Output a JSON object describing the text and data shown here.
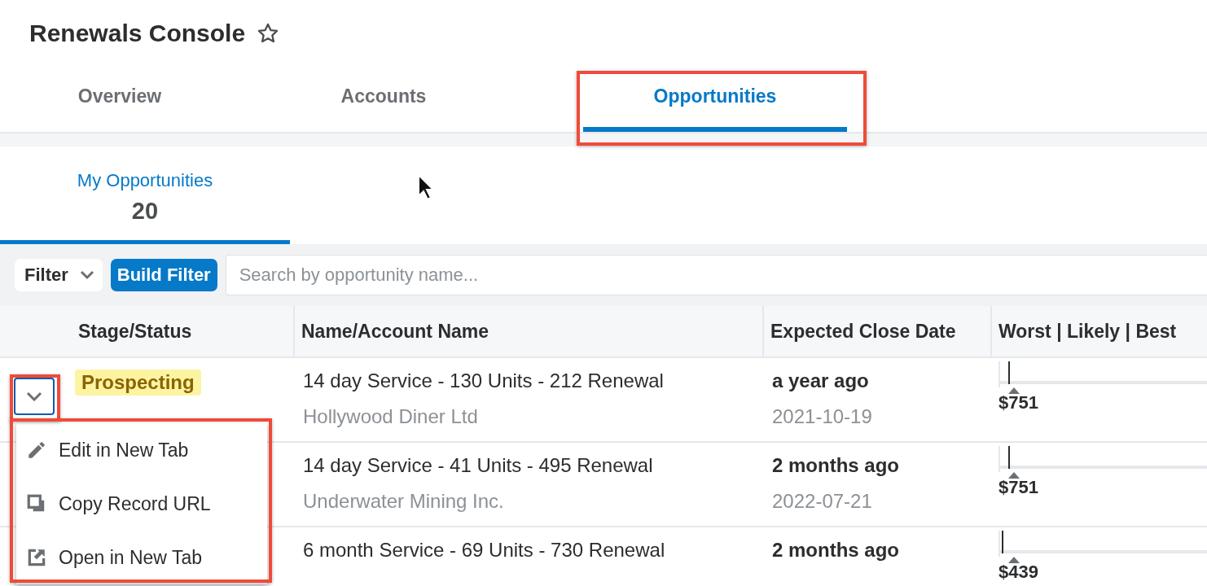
{
  "page": {
    "title": "Renewals Console"
  },
  "tabs": [
    {
      "label": "Overview",
      "selected": false
    },
    {
      "label": "Accounts",
      "selected": false
    },
    {
      "label": "Opportunities",
      "selected": true
    }
  ],
  "list_tabs": [
    {
      "label": "My Opportunities",
      "count": "20",
      "selected": true
    }
  ],
  "filter": {
    "filter_label": "Filter",
    "build_filter": "Build Filter",
    "search": {
      "placeholder": "Search by opportunity name..."
    }
  },
  "table": {
    "columns": [
      "Stage/Status",
      "Name/Account Name",
      "Expected Close Date",
      "Worst | Likely | Best"
    ],
    "rows": [
      {
        "stage": "Prospecting",
        "name": "14 day Service - 130 Units - 212 Renewal",
        "account": "Hollywood Diner Ltd",
        "close_relative": "a year ago",
        "close_date": "2021-10-19",
        "amount": "$751"
      },
      {
        "name": "14 day Service - 41 Units - 495 Renewal",
        "account": "Underwater Mining Inc.",
        "close_relative": "2 months ago",
        "close_date": "2022-07-21",
        "amount": "$751"
      },
      {
        "name": "6 month Service - 69 Units - 730 Renewal",
        "close_relative": "2 months ago",
        "amount": "$439"
      }
    ]
  },
  "row_menu": {
    "items": [
      {
        "label": "Edit in New Tab",
        "kind": "edit"
      },
      {
        "label": "Copy Record URL",
        "kind": "copy"
      },
      {
        "label": "Open in New Tab",
        "kind": "open"
      }
    ]
  }
}
